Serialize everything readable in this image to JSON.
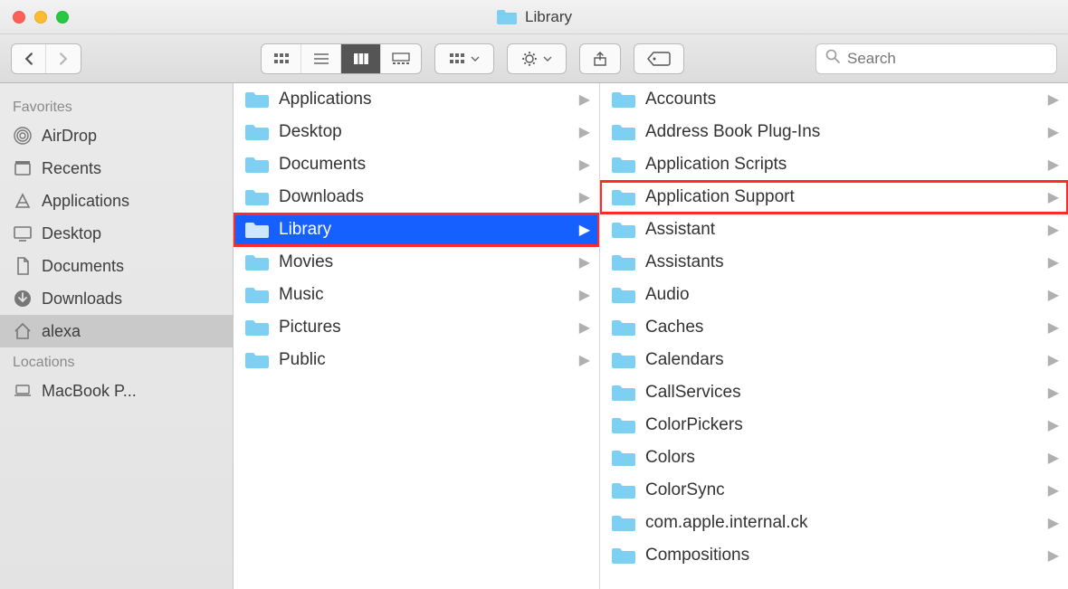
{
  "window": {
    "title": "Library"
  },
  "toolbar": {
    "search_placeholder": "Search"
  },
  "sidebar": {
    "sections": [
      {
        "header": "Favorites",
        "items": [
          {
            "icon": "airdrop",
            "label": "AirDrop",
            "selected": false
          },
          {
            "icon": "recents",
            "label": "Recents",
            "selected": false
          },
          {
            "icon": "apps",
            "label": "Applications",
            "selected": false
          },
          {
            "icon": "desktop",
            "label": "Desktop",
            "selected": false
          },
          {
            "icon": "docs",
            "label": "Documents",
            "selected": false
          },
          {
            "icon": "downloads",
            "label": "Downloads",
            "selected": false
          },
          {
            "icon": "home",
            "label": "alexa",
            "selected": true
          }
        ]
      },
      {
        "header": "Locations",
        "items": [
          {
            "icon": "laptop",
            "label": "MacBook P...",
            "selected": false
          }
        ]
      }
    ]
  },
  "columns": [
    {
      "items": [
        {
          "label": "Applications",
          "selected": false,
          "highlight": false
        },
        {
          "label": "Desktop",
          "selected": false,
          "highlight": false
        },
        {
          "label": "Documents",
          "selected": false,
          "highlight": false
        },
        {
          "label": "Downloads",
          "selected": false,
          "highlight": false
        },
        {
          "label": "Library",
          "selected": true,
          "highlight": true
        },
        {
          "label": "Movies",
          "selected": false,
          "highlight": false
        },
        {
          "label": "Music",
          "selected": false,
          "highlight": false
        },
        {
          "label": "Pictures",
          "selected": false,
          "highlight": false
        },
        {
          "label": "Public",
          "selected": false,
          "highlight": false
        }
      ]
    },
    {
      "items": [
        {
          "label": "Accounts",
          "selected": false,
          "highlight": false
        },
        {
          "label": "Address Book Plug-Ins",
          "selected": false,
          "highlight": false
        },
        {
          "label": "Application Scripts",
          "selected": false,
          "highlight": false
        },
        {
          "label": "Application Support",
          "selected": false,
          "highlight": true
        },
        {
          "label": "Assistant",
          "selected": false,
          "highlight": false
        },
        {
          "label": "Assistants",
          "selected": false,
          "highlight": false
        },
        {
          "label": "Audio",
          "selected": false,
          "highlight": false
        },
        {
          "label": "Caches",
          "selected": false,
          "highlight": false
        },
        {
          "label": "Calendars",
          "selected": false,
          "highlight": false
        },
        {
          "label": "CallServices",
          "selected": false,
          "highlight": false
        },
        {
          "label": "ColorPickers",
          "selected": false,
          "highlight": false
        },
        {
          "label": "Colors",
          "selected": false,
          "highlight": false
        },
        {
          "label": "ColorSync",
          "selected": false,
          "highlight": false
        },
        {
          "label": "com.apple.internal.ck",
          "selected": false,
          "highlight": false
        },
        {
          "label": "Compositions",
          "selected": false,
          "highlight": false
        }
      ]
    }
  ]
}
